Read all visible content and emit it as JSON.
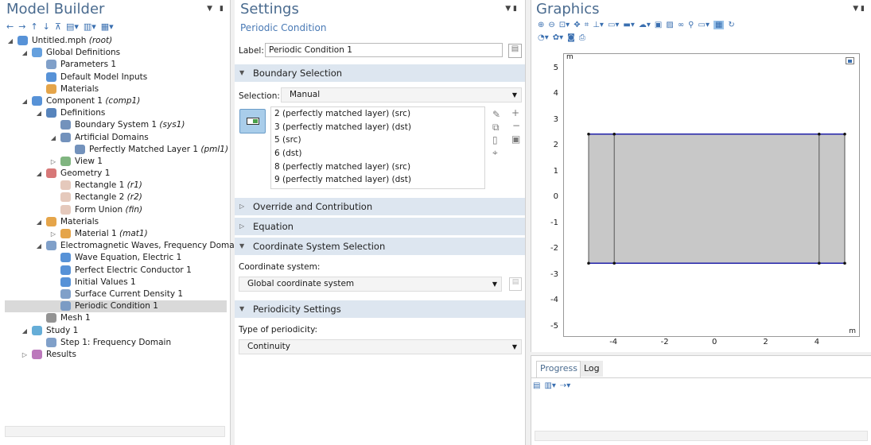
{
  "model_builder": {
    "title": "Model Builder",
    "tree": [
      {
        "label": "Untitled.mph",
        "tag": "(root)",
        "depth": 0,
        "toggle": "open",
        "icon": "model-icon",
        "color": "#3a7fd0"
      },
      {
        "label": "Global Definitions",
        "tag": "",
        "depth": 1,
        "toggle": "open",
        "icon": "globe-icon",
        "color": "#4a8fd8"
      },
      {
        "label": "Parameters 1",
        "tag": "",
        "depth": 2,
        "toggle": "",
        "icon": "parameters-icon",
        "color": "#6a8fc0"
      },
      {
        "label": "Default Model Inputs",
        "tag": "",
        "depth": 2,
        "toggle": "",
        "icon": "model-inputs-icon",
        "color": "#3a7fd0"
      },
      {
        "label": "Materials",
        "tag": "",
        "depth": 2,
        "toggle": "",
        "icon": "materials-icon",
        "color": "#e0952a"
      },
      {
        "label": "Component 1",
        "tag": "(comp1)",
        "depth": 1,
        "toggle": "open",
        "icon": "component-icon",
        "color": "#3a7fd0"
      },
      {
        "label": "Definitions",
        "tag": "",
        "depth": 2,
        "toggle": "open",
        "icon": "definitions-icon",
        "color": "#3a6fb0"
      },
      {
        "label": "Boundary System 1",
        "tag": "(sys1)",
        "depth": 3,
        "toggle": "",
        "icon": "boundary-system-icon",
        "color": "#5a7fb0"
      },
      {
        "label": "Artificial Domains",
        "tag": "",
        "depth": 3,
        "toggle": "open",
        "icon": "artificial-domains-icon",
        "color": "#5a7fb0"
      },
      {
        "label": "Perfectly Matched Layer 1",
        "tag": "(pml1)",
        "depth": 4,
        "toggle": "",
        "icon": "pml-icon",
        "color": "#5a7fb0"
      },
      {
        "label": "View 1",
        "tag": "",
        "depth": 3,
        "toggle": "closed",
        "icon": "view-icon",
        "color": "#6aa86a"
      },
      {
        "label": "Geometry 1",
        "tag": "",
        "depth": 2,
        "toggle": "open",
        "icon": "geometry-icon",
        "color": "#d06060"
      },
      {
        "label": "Rectangle 1",
        "tag": "(r1)",
        "depth": 3,
        "toggle": "",
        "icon": "rectangle-icon",
        "color": "#e0c0b0"
      },
      {
        "label": "Rectangle 2",
        "tag": "(r2)",
        "depth": 3,
        "toggle": "",
        "icon": "rectangle-icon",
        "color": "#e0c0b0"
      },
      {
        "label": "Form Union",
        "tag": "(fin)",
        "depth": 3,
        "toggle": "",
        "icon": "form-union-icon",
        "color": "#e0c0b0"
      },
      {
        "label": "Materials",
        "tag": "",
        "depth": 2,
        "toggle": "open",
        "icon": "materials-icon",
        "color": "#e0952a"
      },
      {
        "label": "Material 1",
        "tag": "(mat1)",
        "depth": 3,
        "toggle": "closed",
        "icon": "material-icon",
        "color": "#e0952a"
      },
      {
        "label": "Electromagnetic Waves, Frequency Domain",
        "tag": "",
        "depth": 2,
        "toggle": "open",
        "icon": "physics-icon",
        "color": "#6a8fc0"
      },
      {
        "label": "Wave Equation, Electric 1",
        "tag": "",
        "depth": 3,
        "toggle": "",
        "icon": "wave-equation-icon",
        "color": "#3a7fd0"
      },
      {
        "label": "Perfect Electric Conductor 1",
        "tag": "",
        "depth": 3,
        "toggle": "",
        "icon": "pec-icon",
        "color": "#3a7fd0"
      },
      {
        "label": "Initial Values 1",
        "tag": "",
        "depth": 3,
        "toggle": "",
        "icon": "initial-values-icon",
        "color": "#3a7fd0"
      },
      {
        "label": "Surface Current Density 1",
        "tag": "",
        "depth": 3,
        "toggle": "",
        "icon": "surface-current-icon",
        "color": "#6a8fc0"
      },
      {
        "label": "Periodic Condition 1",
        "tag": "",
        "depth": 3,
        "toggle": "",
        "icon": "periodic-condition-icon",
        "color": "#6a8fc0",
        "selected": true
      },
      {
        "label": "Mesh 1",
        "tag": "",
        "depth": 2,
        "toggle": "",
        "icon": "mesh-icon",
        "color": "#808080"
      },
      {
        "label": "Study 1",
        "tag": "",
        "depth": 1,
        "toggle": "open",
        "icon": "study-icon",
        "color": "#4a9fd0"
      },
      {
        "label": "Step 1: Frequency Domain",
        "tag": "",
        "depth": 2,
        "toggle": "",
        "icon": "study-step-icon",
        "color": "#6a8fc0"
      },
      {
        "label": "Results",
        "tag": "",
        "depth": 1,
        "toggle": "closed",
        "icon": "results-icon",
        "color": "#b060b0"
      }
    ]
  },
  "settings": {
    "title": "Settings",
    "subtitle": "Periodic Condition",
    "label_caption": "Label:",
    "label_value": "Periodic Condition 1",
    "boundary_section": "Boundary Selection",
    "selection_caption": "Selection:",
    "selection_value": "Manual",
    "boundaries": [
      "2 (perfectly matched layer) (src)",
      "3 (perfectly matched layer) (dst)",
      "5 (src)",
      "6 (dst)",
      "8 (perfectly matched layer) (src)",
      "9 (perfectly matched layer) (dst)"
    ],
    "override_section": "Override and Contribution",
    "equation_section": "Equation",
    "coord_section": "Coordinate System Selection",
    "coord_caption": "Coordinate system:",
    "coord_value": "Global coordinate system",
    "periodicity_section": "Periodicity Settings",
    "periodicity_caption": "Type of periodicity:",
    "periodicity_value": "Continuity"
  },
  "graphics": {
    "title": "Graphics",
    "unit_top": "m",
    "unit_right": "m",
    "y_ticks": [
      "5",
      "4",
      "3",
      "2",
      "1",
      "0",
      "-1",
      "-2",
      "-3",
      "-4",
      "-5"
    ],
    "x_ticks": [
      "-4",
      "-2",
      "0",
      "2",
      "4"
    ],
    "geometry": {
      "x_range": [
        -5.0,
        5.0
      ],
      "y_range": [
        -2.5,
        2.5
      ],
      "inner_lines_x": [
        -4.0,
        4.0
      ],
      "fill": "#c8c8c8",
      "edge": "#2222aa"
    }
  },
  "progress": {
    "tab_progress": "Progress",
    "tab_log": "Log"
  }
}
